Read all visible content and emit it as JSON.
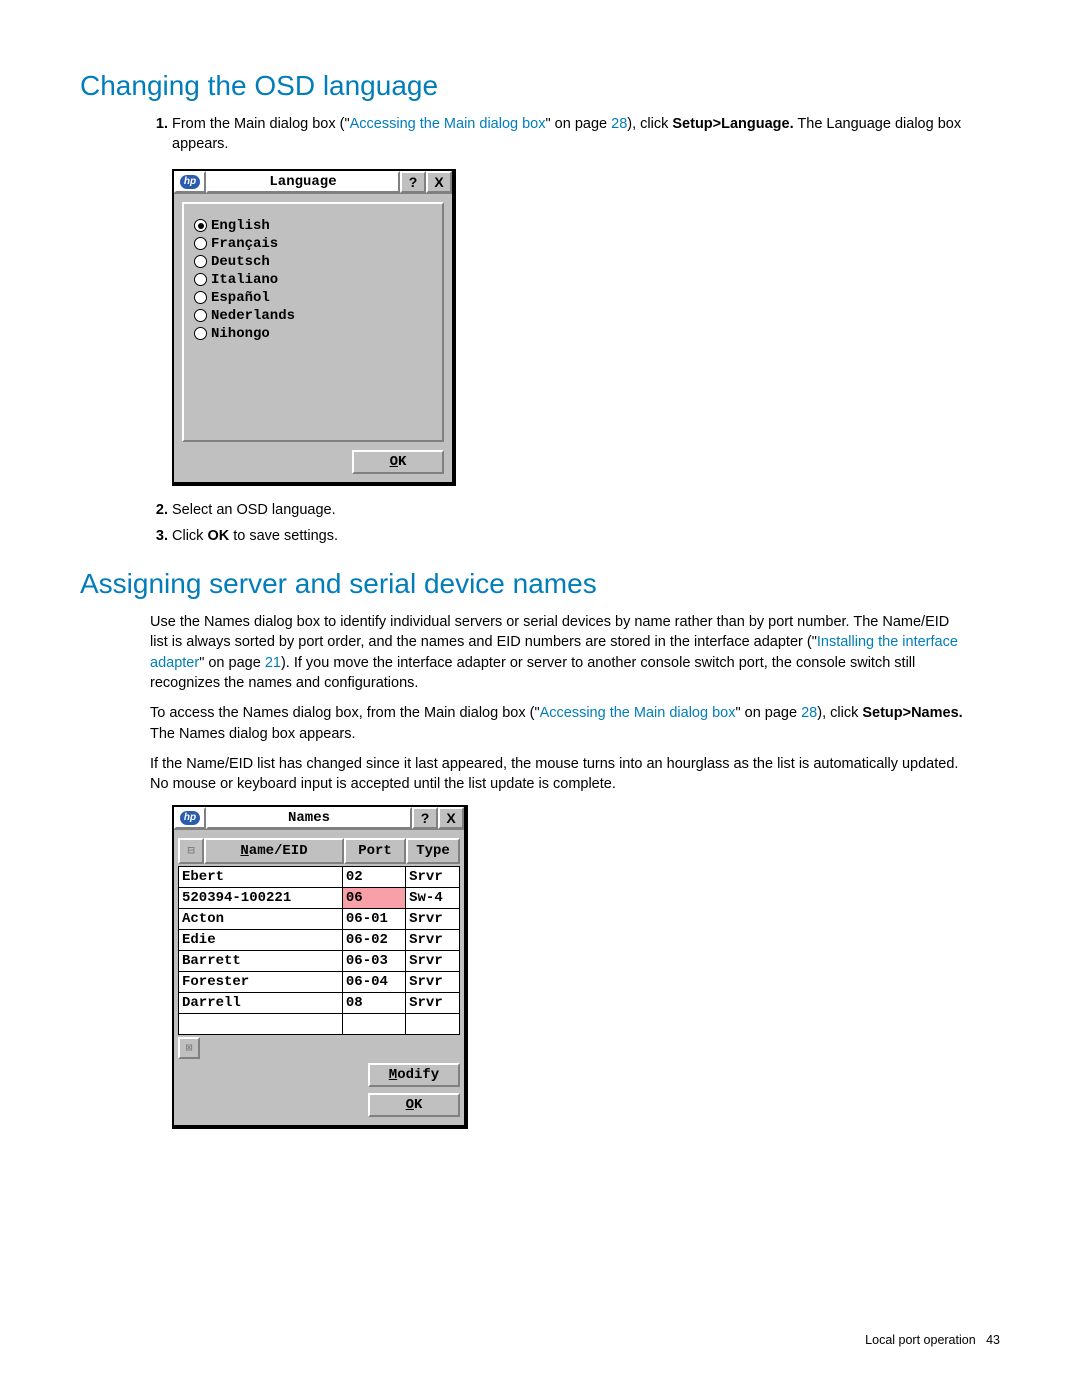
{
  "section1": {
    "heading": "Changing the OSD language",
    "step1_a": "From the Main dialog box (\"",
    "step1_link": "Accessing the Main dialog box",
    "step1_b": "\" on page ",
    "step1_page": "28",
    "step1_c": "), click ",
    "step1_bold": "Setup>Language.",
    "step1_d": " The Language dialog box appears.",
    "step2": "Select an OSD language.",
    "step3_a": "Click ",
    "step3_bold": "OK",
    "step3_b": " to save settings."
  },
  "langDialog": {
    "logo": "hp",
    "title": "Language",
    "help": "?",
    "close": "X",
    "ok_u": "O",
    "ok_rest": "K",
    "options": [
      {
        "label": "English",
        "selected": true
      },
      {
        "label": "Français",
        "selected": false
      },
      {
        "label": "Deutsch",
        "selected": false
      },
      {
        "label": "Italiano",
        "selected": false
      },
      {
        "label": "Español",
        "selected": false
      },
      {
        "label": "Nederlands",
        "selected": false
      },
      {
        "label": "Nihongo",
        "selected": false
      }
    ]
  },
  "section2": {
    "heading": "Assigning server and serial device names",
    "p1_a": "Use the Names dialog box to identify individual servers or serial devices by name rather than by port number. The Name/EID list is always sorted by port order, and the names and EID numbers are stored in the interface adapter (\"",
    "p1_link": "Installing the interface adapter",
    "p1_b": "\" on page ",
    "p1_page": "21",
    "p1_c": "). If you move the interface adapter or server to another console switch port, the console switch still recognizes the names and configurations.",
    "p2_a": "To access the Names dialog box, from the Main dialog box (\"",
    "p2_link": "Accessing the Main dialog box",
    "p2_b": "\" on page ",
    "p2_page": "28",
    "p2_c": "), click ",
    "p2_bold": "Setup>Names.",
    "p2_d": " The Names dialog box appears.",
    "p3": "If the Name/EID list has changed since it last appeared, the mouse turns into an hourglass as the list is automatically updated. No mouse or keyboard input is accepted until the list update is complete."
  },
  "namesDialog": {
    "logo": "hp",
    "title": "Names",
    "help": "?",
    "close": "X",
    "toggle1": "⊟",
    "toggle2": "⊠",
    "hdr_name_u": "N",
    "hdr_name_rest": "ame/EID",
    "hdr_port": "Port",
    "hdr_type": "Type",
    "modify_u": "M",
    "modify_rest": "odify",
    "ok_u": "O",
    "ok_rest": "K",
    "rows": [
      {
        "name": "Ebert",
        "port": "02",
        "type": "Srvr",
        "hl": false
      },
      {
        "name": "520394-100221",
        "port": "06",
        "type": "Sw-4",
        "hl": true
      },
      {
        "name": "Acton",
        "port": "06-01",
        "type": "Srvr",
        "hl": false
      },
      {
        "name": "Edie",
        "port": "06-02",
        "type": "Srvr",
        "hl": false
      },
      {
        "name": "Barrett",
        "port": "06-03",
        "type": "Srvr",
        "hl": false
      },
      {
        "name": "Forester",
        "port": "06-04",
        "type": "Srvr",
        "hl": false
      },
      {
        "name": "Darrell",
        "port": "08",
        "type": "Srvr",
        "hl": false
      },
      {
        "name": "",
        "port": "",
        "type": "",
        "hl": false
      }
    ]
  },
  "footer": {
    "text": "Local port operation",
    "page": "43"
  }
}
